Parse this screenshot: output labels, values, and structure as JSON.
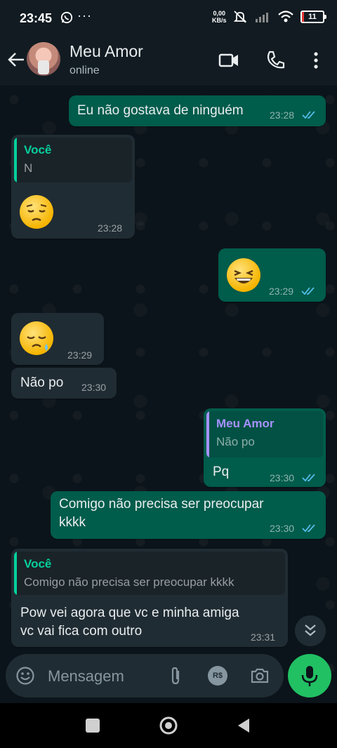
{
  "status_bar": {
    "time": "23:45",
    "more": "···",
    "net_speed_top": "0,00",
    "net_speed_bottom": "KB/s",
    "battery_level": "11",
    "battery_fraction": 0.11
  },
  "header": {
    "contact_name": "Meu Amor",
    "status": "online"
  },
  "messages": [
    {
      "dir": "out",
      "text": "Eu não gostava de ninguém",
      "time": "23:28",
      "read": true
    },
    {
      "dir": "in",
      "quote_author": "Você",
      "quote_text": "N",
      "emoji": "pensive-face",
      "time": "23:28"
    },
    {
      "dir": "out",
      "emoji": "grinning-squinting-face",
      "time": "23:29",
      "read": true
    },
    {
      "dir": "in",
      "emoji": "sleepy-face",
      "time": "23:29"
    },
    {
      "dir": "in",
      "text": "Não po",
      "time": "23:30"
    },
    {
      "dir": "out",
      "quote_author": "Meu Amor",
      "quote_text": "Não po",
      "text": "Pq",
      "time": "23:30",
      "read": true
    },
    {
      "dir": "out",
      "text_line1": "Comigo não precisa ser preocupar",
      "text_line2": "kkkk",
      "time": "23:30",
      "read": true
    },
    {
      "dir": "in",
      "quote_author": "Você",
      "quote_text": "Comigo não precisa ser preocupar kkkk",
      "text_line1": "Pow vei agora que vc e minha amiga",
      "text_line2": "vc vai fica com outro",
      "time": "23:31"
    }
  ],
  "composer": {
    "placeholder": "Mensagem",
    "payment_icon_label": "R$"
  },
  "colors": {
    "outgoing_bubble": "#005c4b",
    "incoming_bubble": "#202c33",
    "read_ticks": "#53bdeb",
    "quote_you": "#06cf9c",
    "quote_contact": "#a791ff",
    "mic_button": "#21c063"
  }
}
